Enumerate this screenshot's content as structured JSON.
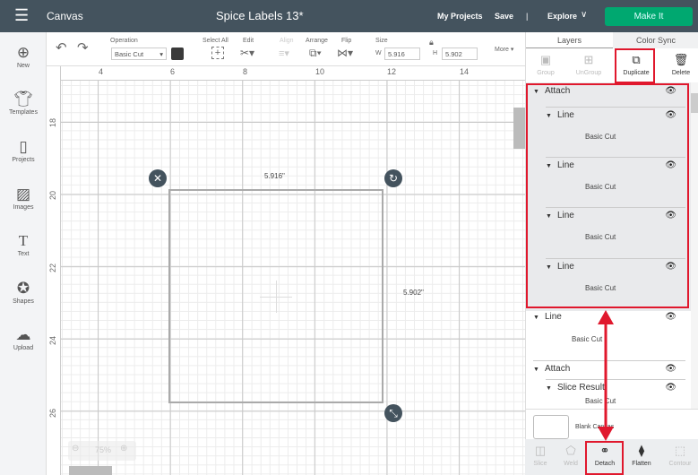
{
  "topbar": {
    "menu_icon": "hamburger-icon",
    "app": "Canvas",
    "title": "Spice Labels 13*",
    "my_projects": "My Projects",
    "save": "Save",
    "sep": "|",
    "explore": "Explore",
    "make_it": "Make It"
  },
  "sidebar": [
    {
      "label": "New",
      "icon": "plus-circle-icon"
    },
    {
      "label": "Templates",
      "icon": "shirt-icon"
    },
    {
      "label": "Projects",
      "icon": "book-icon"
    },
    {
      "label": "Images",
      "icon": "image-icon"
    },
    {
      "label": "Text",
      "icon": "text-icon"
    },
    {
      "label": "Shapes",
      "icon": "shapes-icon"
    },
    {
      "label": "Upload",
      "icon": "cloud-upload-icon"
    }
  ],
  "toolbar": {
    "operation_label": "Operation",
    "operation_value": "Basic Cut",
    "select_all": "Select All",
    "edit": "Edit",
    "align": "Align",
    "arrange": "Arrange",
    "flip": "Flip",
    "size": "Size",
    "w_label": "W",
    "w_value": "5.916",
    "h_label": "H",
    "h_value": "5.902",
    "more": "More ▾",
    "color": "#3a3a3a"
  },
  "ruler": {
    "top": [
      "4",
      "6",
      "8",
      "10",
      "12",
      "14"
    ],
    "left": [
      "18",
      "20",
      "22",
      "24",
      "26"
    ]
  },
  "canvas": {
    "width_label": "5.916\"",
    "height_label": "5.902\"",
    "zoom": "75%"
  },
  "panel": {
    "tabs": [
      "Layers",
      "Color Sync"
    ],
    "tools": [
      {
        "label": "Group",
        "icon": "group-icon",
        "enabled": false
      },
      {
        "label": "UnGroup",
        "icon": "ungroup-icon",
        "enabled": false
      },
      {
        "label": "Duplicate",
        "icon": "duplicate-icon",
        "enabled": true
      },
      {
        "label": "Delete",
        "icon": "trash-icon",
        "enabled": true
      }
    ],
    "layers": [
      {
        "name": "Attach",
        "level": 0
      },
      {
        "name": "Line",
        "level": 1
      },
      {
        "name": "Basic Cut",
        "level": 2
      },
      {
        "name": "Line",
        "level": 1
      },
      {
        "name": "Basic Cut",
        "level": 2
      },
      {
        "name": "Line",
        "level": 1
      },
      {
        "name": "Basic Cut",
        "level": 2
      },
      {
        "name": "Line",
        "level": 1
      },
      {
        "name": "Basic Cut",
        "level": 2
      },
      {
        "name": "Line",
        "level": 0
      },
      {
        "name": "Basic Cut",
        "level": 2
      },
      {
        "name": "Attach",
        "level": 0
      },
      {
        "name": "Slice Result",
        "level": 1
      },
      {
        "name": "Basic Cut",
        "level": 2
      }
    ],
    "blank_canvas": "Blank Canvas",
    "bottom_tools": [
      {
        "label": "Slice",
        "icon": "slice-icon",
        "enabled": false
      },
      {
        "label": "Weld",
        "icon": "weld-icon",
        "enabled": false
      },
      {
        "label": "Detach",
        "icon": "detach-icon",
        "enabled": true
      },
      {
        "label": "Flatten",
        "icon": "flatten-icon",
        "enabled": true
      },
      {
        "label": "Contour",
        "icon": "contour-icon",
        "enabled": false
      }
    ]
  },
  "annotation_color": "#e0182d",
  "accent": "#00a870"
}
